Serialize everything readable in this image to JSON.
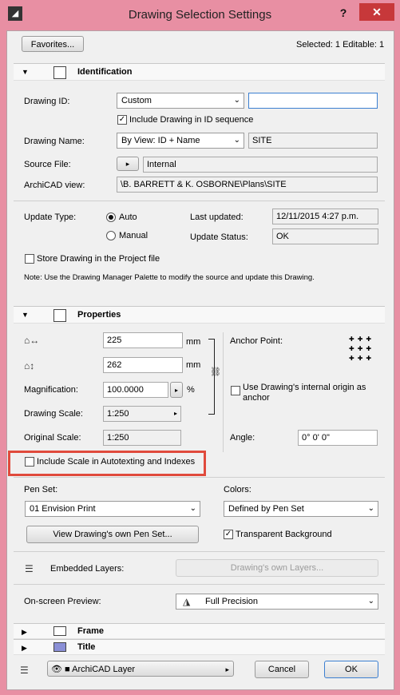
{
  "window": {
    "title": "Drawing Selection Settings",
    "help": "?",
    "close": "✕"
  },
  "top": {
    "favorites": "Favorites...",
    "selected": "Selected: 1 Editable: 1"
  },
  "identification": {
    "title": "Identification",
    "drawing_id_label": "Drawing ID:",
    "drawing_id_value": "Custom",
    "drawing_id_text": "",
    "include_label": "Include Drawing in ID sequence",
    "include_checked": true,
    "drawing_name_label": "Drawing Name:",
    "drawing_name_value": "By View: ID + Name",
    "drawing_name_text": "SITE",
    "source_file_label": "Source File:",
    "source_file_value": "Internal",
    "archicad_view_label": "ArchiCAD view:",
    "archicad_view_value": "\\B. BARRETT & K. OSBORNE\\Plans\\SITE",
    "update_type_label": "Update Type:",
    "auto_label": "Auto",
    "manual_label": "Manual",
    "update_type": "Auto",
    "last_updated_label": "Last updated:",
    "last_updated_value": "12/11/2015 4:27 p.m.",
    "update_status_label": "Update Status:",
    "update_status_value": "OK",
    "store_label": "Store Drawing in the Project file",
    "note": "Note:   Use the Drawing Manager Palette to modify the source and update this Drawing."
  },
  "properties": {
    "title": "Properties",
    "width_value": "225",
    "height_value": "262",
    "unit": "mm",
    "magnification_label": "Magnification:",
    "magnification_value": "100.0000",
    "percent": "%",
    "drawing_scale_label": "Drawing Scale:",
    "drawing_scale_value": "1:250",
    "original_scale_label": "Original Scale:",
    "original_scale_value": "1:250",
    "anchor_label": "Anchor Point:",
    "use_origin_label": "Use Drawing's internal origin as anchor",
    "angle_label": "Angle:",
    "angle_value": "0° 0' 0\"",
    "include_scale_label": "Include Scale in Autotexting and Indexes",
    "pen_set_label": "Pen Set:",
    "pen_set_value": "01 Envision Print",
    "colors_label": "Colors:",
    "colors_value": "Defined by Pen Set",
    "view_pen_set": "View Drawing's own Pen Set...",
    "transparent_label": "Transparent Background",
    "embedded_label": "Embedded Layers:",
    "own_layers": "Drawing's own Layers...",
    "preview_label": "On-screen Preview:",
    "preview_value": "Full Precision"
  },
  "frame": {
    "title": "Frame"
  },
  "title_section": {
    "title": "Title"
  },
  "bottom": {
    "layer_value": "ArchiCAD Layer",
    "cancel": "Cancel",
    "ok": "OK"
  }
}
